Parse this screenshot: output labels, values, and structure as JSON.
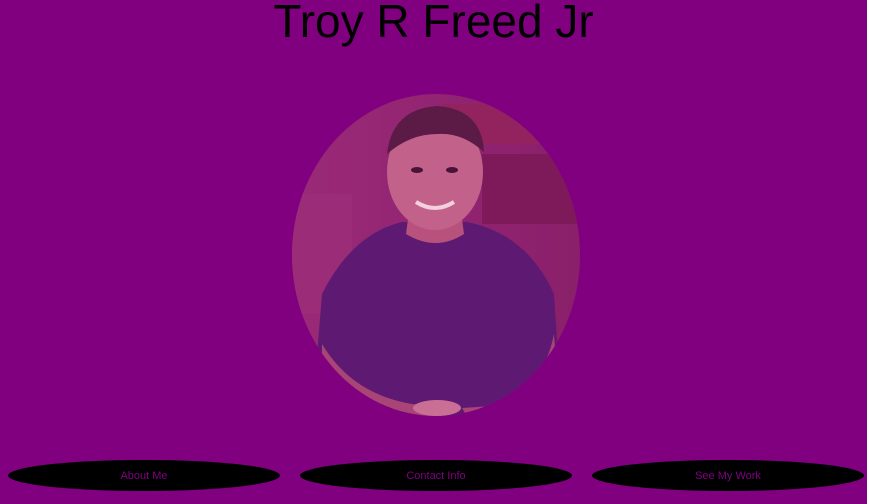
{
  "header": {
    "title": "Troy R Freed Jr"
  },
  "colors": {
    "background": "#800080",
    "button_fill": "#000000",
    "button_text": "#800080",
    "title_text": "#000000"
  },
  "portrait": {
    "icon": "person-photo"
  },
  "nav": {
    "about_label": "About Me",
    "contact_label": "Contact Info",
    "work_label": "See My Work"
  }
}
